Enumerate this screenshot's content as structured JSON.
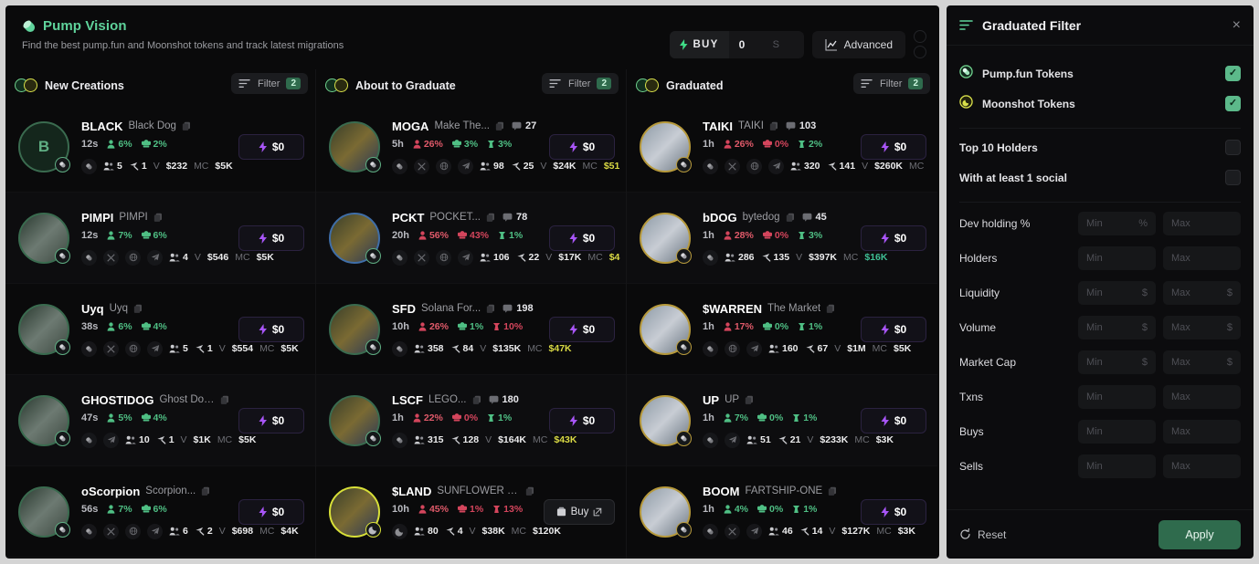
{
  "header": {
    "brand_icon": "pill-icon",
    "title": "Pump Vision",
    "subtitle": "Find the best pump.fun and Moonshot tokens and track latest migrations",
    "buy_label": "BUY",
    "buy_amount": "0",
    "buy_currency": "S",
    "advanced_label": "Advanced"
  },
  "columns": [
    {
      "title": "New Creations",
      "filter_label": "Filter",
      "filter_count": "2",
      "cards": [
        {
          "symbol": "BLACK",
          "name": "Black Dog",
          "age": "12s",
          "avatar_letter": "B",
          "ring": "green",
          "holders_pct": "6%",
          "top_pct": "2%",
          "extra_pct": "",
          "holders_color": "g",
          "top_color": "g",
          "extra_color": "",
          "comments": "",
          "socials": [
            "pill-icon"
          ],
          "m_users": "5",
          "m_trades": "1",
          "m_vol": "$232",
          "m_mc": "$5K",
          "mc_color": "",
          "buy_label": "$0",
          "buy_style": "primary"
        },
        {
          "symbol": "PIMPI",
          "name": "PIMPI",
          "age": "12s",
          "avatar_letter": "",
          "ring": "green",
          "holders_pct": "7%",
          "top_pct": "6%",
          "extra_pct": "",
          "holders_color": "g",
          "top_color": "g",
          "extra_color": "",
          "comments": "",
          "socials": [
            "pill-icon",
            "x-icon",
            "globe-icon",
            "telegram-icon"
          ],
          "m_users": "4",
          "m_trades": "",
          "m_vol": "$546",
          "m_mc": "$5K",
          "mc_color": "",
          "buy_label": "$0",
          "buy_style": "primary"
        },
        {
          "symbol": "Uyq",
          "name": "Uyq",
          "age": "38s",
          "avatar_letter": "",
          "ring": "green",
          "holders_pct": "6%",
          "top_pct": "4%",
          "extra_pct": "",
          "holders_color": "g",
          "top_color": "g",
          "extra_color": "",
          "comments": "",
          "socials": [
            "pill-icon",
            "x-icon",
            "globe-icon",
            "telegram-icon"
          ],
          "m_users": "5",
          "m_trades": "1",
          "m_vol": "$554",
          "m_mc": "$5K",
          "mc_color": "",
          "buy_label": "$0",
          "buy_style": "primary"
        },
        {
          "symbol": "GHOSTIDOG",
          "name": "Ghost Doggu",
          "age": "47s",
          "avatar_letter": "",
          "ring": "green",
          "holders_pct": "5%",
          "top_pct": "4%",
          "extra_pct": "",
          "holders_color": "g",
          "top_color": "g",
          "extra_color": "",
          "comments": "",
          "socials": [
            "pill-icon",
            "telegram-icon"
          ],
          "m_users": "10",
          "m_trades": "1",
          "m_vol": "$1K",
          "m_mc": "$5K",
          "mc_color": "",
          "buy_label": "$0",
          "buy_style": "primary"
        },
        {
          "symbol": "oScorpion",
          "name": "Scorpion...",
          "age": "56s",
          "avatar_letter": "",
          "ring": "green",
          "holders_pct": "7%",
          "top_pct": "6%",
          "extra_pct": "",
          "holders_color": "g",
          "top_color": "g",
          "extra_color": "",
          "comments": "",
          "socials": [
            "pill-icon",
            "x-icon",
            "globe-icon",
            "telegram-icon"
          ],
          "m_users": "6",
          "m_trades": "2",
          "m_vol": "$698",
          "m_mc": "$4K",
          "mc_color": "",
          "buy_label": "$0",
          "buy_style": "primary"
        }
      ]
    },
    {
      "title": "About to Graduate",
      "filter_label": "Filter",
      "filter_count": "2",
      "cards": [
        {
          "symbol": "MOGA",
          "name": "Make The...",
          "age": "5h",
          "avatar_letter": "",
          "ring": "green",
          "holders_pct": "26%",
          "top_pct": "3%",
          "extra_pct": "3%",
          "holders_color": "r",
          "top_color": "g",
          "extra_color": "g",
          "comments": "27",
          "socials": [
            "pill-icon",
            "x-icon",
            "globe-icon",
            "telegram-icon"
          ],
          "m_users": "98",
          "m_trades": "25",
          "m_vol": "$24K",
          "m_mc": "$51",
          "mc_color": "yel",
          "buy_label": "$0",
          "buy_style": "primary"
        },
        {
          "symbol": "PCKT",
          "name": "POCKET...",
          "age": "20h",
          "avatar_letter": "",
          "ring": "blue",
          "holders_pct": "56%",
          "top_pct": "43%",
          "extra_pct": "1%",
          "holders_color": "r",
          "top_color": "rr",
          "extra_color": "g",
          "comments": "78",
          "socials": [
            "pill-icon",
            "x-icon",
            "globe-icon",
            "telegram-icon"
          ],
          "m_users": "106",
          "m_trades": "22",
          "m_vol": "$17K",
          "m_mc": "$4",
          "mc_color": "yel",
          "buy_label": "$0",
          "buy_style": "primary"
        },
        {
          "symbol": "SFD",
          "name": "Solana For...",
          "age": "10h",
          "avatar_letter": "",
          "ring": "green",
          "holders_pct": "26%",
          "top_pct": "1%",
          "extra_pct": "10%",
          "holders_color": "r",
          "top_color": "g",
          "extra_color": "rr",
          "comments": "198",
          "socials": [
            "pill-icon"
          ],
          "m_users": "358",
          "m_trades": "84",
          "m_vol": "$135K",
          "m_mc": "$47K",
          "mc_color": "yel",
          "buy_label": "$0",
          "buy_style": "primary"
        },
        {
          "symbol": "LSCF",
          "name": "LEGO...",
          "age": "1h",
          "avatar_letter": "",
          "ring": "green",
          "holders_pct": "22%",
          "top_pct": "0%",
          "extra_pct": "1%",
          "holders_color": "r",
          "top_color": "rr",
          "extra_color": "g",
          "comments": "180",
          "socials": [
            "pill-icon"
          ],
          "m_users": "315",
          "m_trades": "128",
          "m_vol": "$164K",
          "m_mc": "$43K",
          "mc_color": "yel",
          "buy_label": "$0",
          "buy_style": "primary"
        },
        {
          "symbol": "$LAND",
          "name": "SUNFLOWER LAND",
          "age": "10h",
          "avatar_letter": "",
          "ring": "yellow",
          "holders_pct": "45%",
          "top_pct": "1%",
          "extra_pct": "13%",
          "holders_color": "r",
          "top_color": "rr",
          "extra_color": "rr",
          "comments": "",
          "socials": [
            "moon-icon"
          ],
          "m_users": "80",
          "m_trades": "4",
          "m_vol": "$38K",
          "m_mc": "$120K",
          "mc_color": "",
          "buy_label": "Buy",
          "buy_style": "buy"
        }
      ]
    },
    {
      "title": "Graduated",
      "filter_label": "Filter",
      "filter_count": "2",
      "cards": [
        {
          "symbol": "TAIKI",
          "name": "TAIKI",
          "age": "1h",
          "avatar_letter": "",
          "ring": "gold",
          "holders_pct": "26%",
          "top_pct": "0%",
          "extra_pct": "2%",
          "holders_color": "r",
          "top_color": "rr",
          "extra_color": "g",
          "comments": "103",
          "socials": [
            "pill-icon",
            "x-icon",
            "globe-icon",
            "telegram-icon"
          ],
          "m_users": "320",
          "m_trades": "141",
          "m_vol": "$260K",
          "m_mc": "",
          "mc_color": "",
          "buy_label": "$0",
          "buy_style": "primary"
        },
        {
          "symbol": "bDOG",
          "name": "bytedog",
          "age": "1h",
          "avatar_letter": "",
          "ring": "gold",
          "holders_pct": "28%",
          "top_pct": "0%",
          "extra_pct": "3%",
          "holders_color": "r",
          "top_color": "rr",
          "extra_color": "g",
          "comments": "45",
          "socials": [
            "pill-icon"
          ],
          "m_users": "286",
          "m_trades": "135",
          "m_vol": "$397K",
          "m_mc": "$16K",
          "mc_color": "teal",
          "buy_label": "$0",
          "buy_style": "primary"
        },
        {
          "symbol": "$WARREN",
          "name": "The Market",
          "age": "1h",
          "avatar_letter": "",
          "ring": "gold",
          "holders_pct": "17%",
          "top_pct": "0%",
          "extra_pct": "1%",
          "holders_color": "r",
          "top_color": "g",
          "extra_color": "g",
          "comments": "",
          "socials": [
            "pill-icon",
            "globe-icon",
            "telegram-icon"
          ],
          "m_users": "160",
          "m_trades": "67",
          "m_vol": "$1M",
          "m_mc": "$5K",
          "mc_color": "",
          "buy_label": "$0",
          "buy_style": "primary"
        },
        {
          "symbol": "UP",
          "name": "UP",
          "age": "1h",
          "avatar_letter": "",
          "ring": "gold",
          "holders_pct": "7%",
          "top_pct": "0%",
          "extra_pct": "1%",
          "holders_color": "g",
          "top_color": "g",
          "extra_color": "g",
          "comments": "",
          "socials": [
            "pill-icon",
            "telegram-icon"
          ],
          "m_users": "51",
          "m_trades": "21",
          "m_vol": "$233K",
          "m_mc": "$3K",
          "mc_color": "",
          "buy_label": "$0",
          "buy_style": "primary"
        },
        {
          "symbol": "BOOM",
          "name": "FARTSHIP-ONE",
          "age": "1h",
          "avatar_letter": "",
          "ring": "gold",
          "holders_pct": "4%",
          "top_pct": "0%",
          "extra_pct": "1%",
          "holders_color": "g",
          "top_color": "g",
          "extra_color": "g",
          "comments": "",
          "socials": [
            "pill-icon",
            "x-icon",
            "telegram-icon"
          ],
          "m_users": "46",
          "m_trades": "14",
          "m_vol": "$127K",
          "m_mc": "$3K",
          "mc_color": "",
          "buy_label": "$0",
          "buy_style": "primary"
        }
      ]
    }
  ],
  "panel": {
    "title": "Graduated Filter",
    "close": "×",
    "toggles": [
      {
        "label": "Pump.fun Tokens",
        "icon": "pump-icon",
        "checked": true
      },
      {
        "label": "Moonshot Tokens",
        "icon": "moon-icon",
        "checked": true
      }
    ],
    "options": [
      {
        "label": "Top 10 Holders",
        "checked": false
      },
      {
        "label": "With at least 1 social",
        "checked": false
      }
    ],
    "ranges": [
      {
        "label": "Dev holding %",
        "min_ph": "Min",
        "max_ph": "Max",
        "min_suffix": "%",
        "max_suffix": ""
      },
      {
        "label": "Holders",
        "min_ph": "Min",
        "max_ph": "Max",
        "min_suffix": "",
        "max_suffix": ""
      },
      {
        "label": "Liquidity",
        "min_ph": "Min",
        "max_ph": "Max",
        "min_suffix": "$",
        "max_suffix": "$"
      },
      {
        "label": "Volume",
        "min_ph": "Min",
        "max_ph": "Max",
        "min_suffix": "$",
        "max_suffix": "$"
      },
      {
        "label": "Market Cap",
        "min_ph": "Min",
        "max_ph": "Max",
        "min_suffix": "$",
        "max_suffix": "$"
      },
      {
        "label": "Txns",
        "min_ph": "Min",
        "max_ph": "Max",
        "min_suffix": "",
        "max_suffix": ""
      },
      {
        "label": "Buys",
        "min_ph": "Min",
        "max_ph": "Max",
        "min_suffix": "",
        "max_suffix": ""
      },
      {
        "label": "Sells",
        "min_ph": "Min",
        "max_ph": "Max",
        "min_suffix": "",
        "max_suffix": ""
      }
    ],
    "reset_label": "Reset",
    "apply_label": "Apply"
  },
  "colors": {
    "accent_green": "#5fd39b",
    "brand_green": "#2f6b4d",
    "purple": "#a855f7",
    "gold": "#b79a3c",
    "yellow": "#d9d944",
    "red": "#d4455c",
    "bg": "#0a0a0b"
  }
}
